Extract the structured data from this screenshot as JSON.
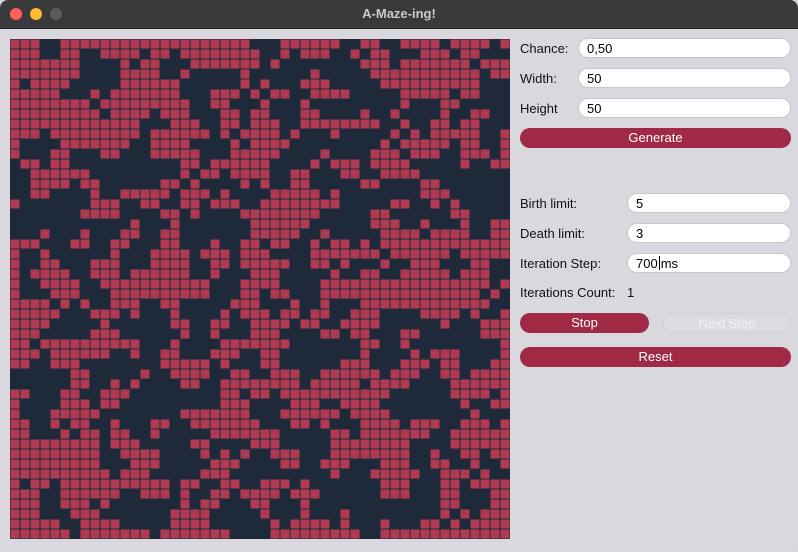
{
  "window": {
    "title": "A-Maze-ing!"
  },
  "colors": {
    "accent": "#a02a45",
    "cell_alive": "#b03a52",
    "cell_dead": "#1e2a3a"
  },
  "controls": {
    "chance": {
      "label": "Chance:",
      "value": "0,50"
    },
    "width": {
      "label": "Width:",
      "value": "50"
    },
    "height": {
      "label": "Height",
      "value": "50"
    },
    "generate_label": "Generate",
    "birth_limit": {
      "label": "Birth limit:",
      "value": "5"
    },
    "death_limit": {
      "label": "Death limit:",
      "value": "3"
    },
    "iteration_step": {
      "label": "Iteration Step:",
      "value": "700",
      "unit": "ms"
    },
    "iterations_count": {
      "label": "Iterations Count:",
      "value": "1"
    },
    "stop_label": "Stop",
    "next_step_label": "Next Step",
    "reset_label": "Reset"
  },
  "maze": {
    "cols": 50,
    "rows": 50,
    "alive_ratio": 0.5
  }
}
